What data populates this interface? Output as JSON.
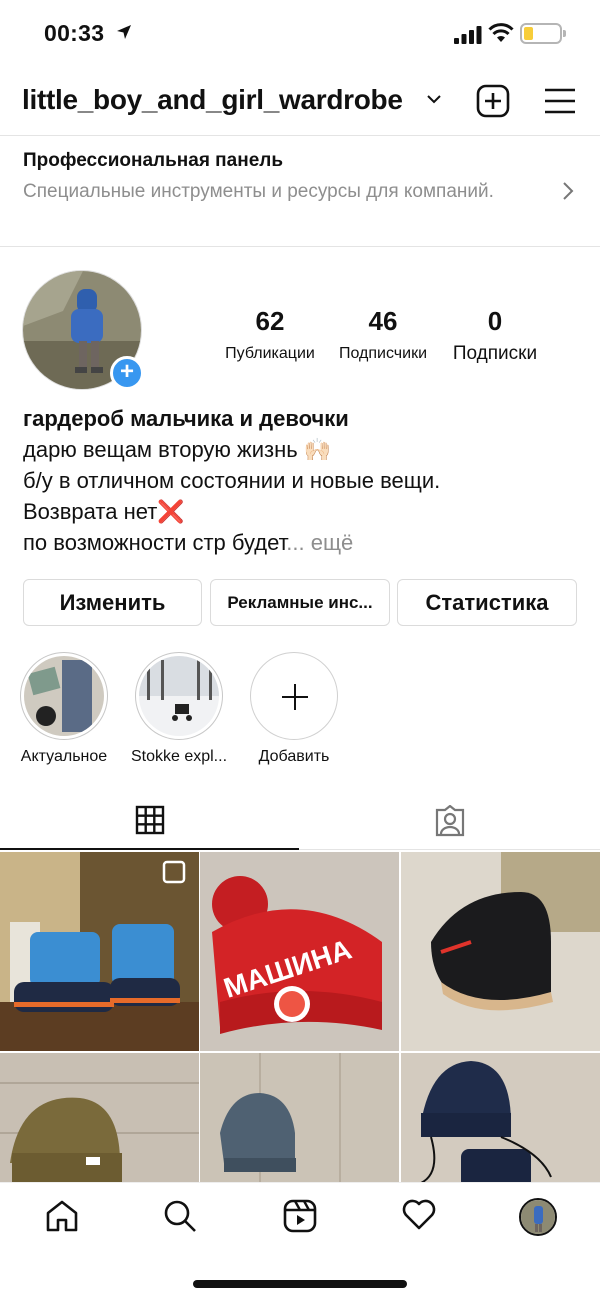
{
  "status_bar": {
    "time": "00:33"
  },
  "header": {
    "username": "little_boy_and_girl_wardrobe"
  },
  "pro_panel": {
    "title": "Профессиональная панель",
    "subtitle": "Специальные инструменты и ресурсы для компаний."
  },
  "stats": [
    {
      "value": "62",
      "label": "Публикации"
    },
    {
      "value": "46",
      "label": "Подписчики"
    },
    {
      "value": "0",
      "label": "Подписки"
    }
  ],
  "bio": {
    "name": "гардероб мальчика и девочки",
    "line1": "дарю вещам вторую жизнь 🙌🏻",
    "line2": "б/у в отличном состоянии и новые вещи.",
    "line3": "Возврата нет❌",
    "line4": "по возможности стр будет",
    "more": "... ещё"
  },
  "buttons": {
    "edit": "Изменить",
    "ads": "Рекламные инс...",
    "stats": "Статистика"
  },
  "highlights": [
    {
      "label": "Актуальное"
    },
    {
      "label": "Stokke expl..."
    },
    {
      "label": "Добавить"
    }
  ],
  "icons": {
    "location": "location-arrow-icon",
    "chevron": "chevron-down-icon",
    "add": "plus-square-icon",
    "menu": "hamburger-menu-icon",
    "grid": "grid-icon",
    "tagged": "tagged-person-icon",
    "home": "home-icon",
    "search": "search-icon",
    "reels": "reels-icon",
    "activity": "heart-icon"
  },
  "colors": {
    "accent": "#3897f0",
    "battery": "#f7cd3a"
  }
}
